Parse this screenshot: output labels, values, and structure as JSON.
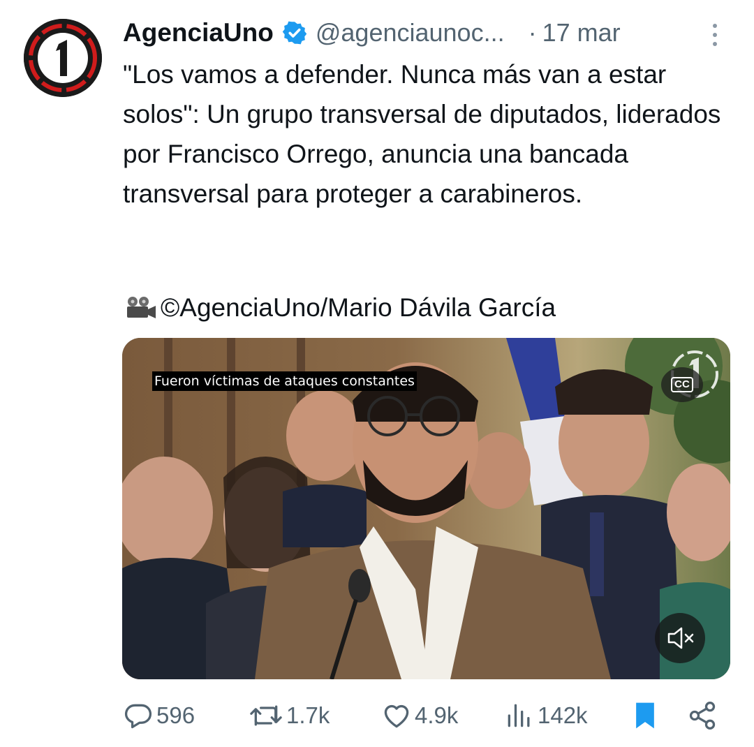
{
  "tweet": {
    "author": {
      "display_name": "AgenciaUno",
      "handle": "@agenciaunoc...",
      "avatar_icon": "agenciauno-logo-icon",
      "verified_icon": "verified-badge-icon"
    },
    "separator": "·",
    "timestamp": "17 mar",
    "text": "\"Los vamos a defender. Nunca más van a estar solos\": Un grupo transversal de diputados, liderados por Francisco Orrego, anuncia una bancada transversal para proteger a carabineros.",
    "credit": "©AgenciaUno/Mario Dávila García",
    "credit_icon": "movie-camera-icon"
  },
  "media": {
    "caption": "Fueron víctimas de ataques constantes",
    "cc_label": "CC",
    "mute_icon": "speaker-muted-icon"
  },
  "actions": {
    "replies": "596",
    "retweets": "1.7k",
    "likes": "4.9k",
    "views": "142k"
  },
  "colors": {
    "text": "#0f1419",
    "secondary": "#536471",
    "verified": "#1d9bf0",
    "bookmark": "#1d9bf0",
    "brand_red": "#d01c1c"
  }
}
